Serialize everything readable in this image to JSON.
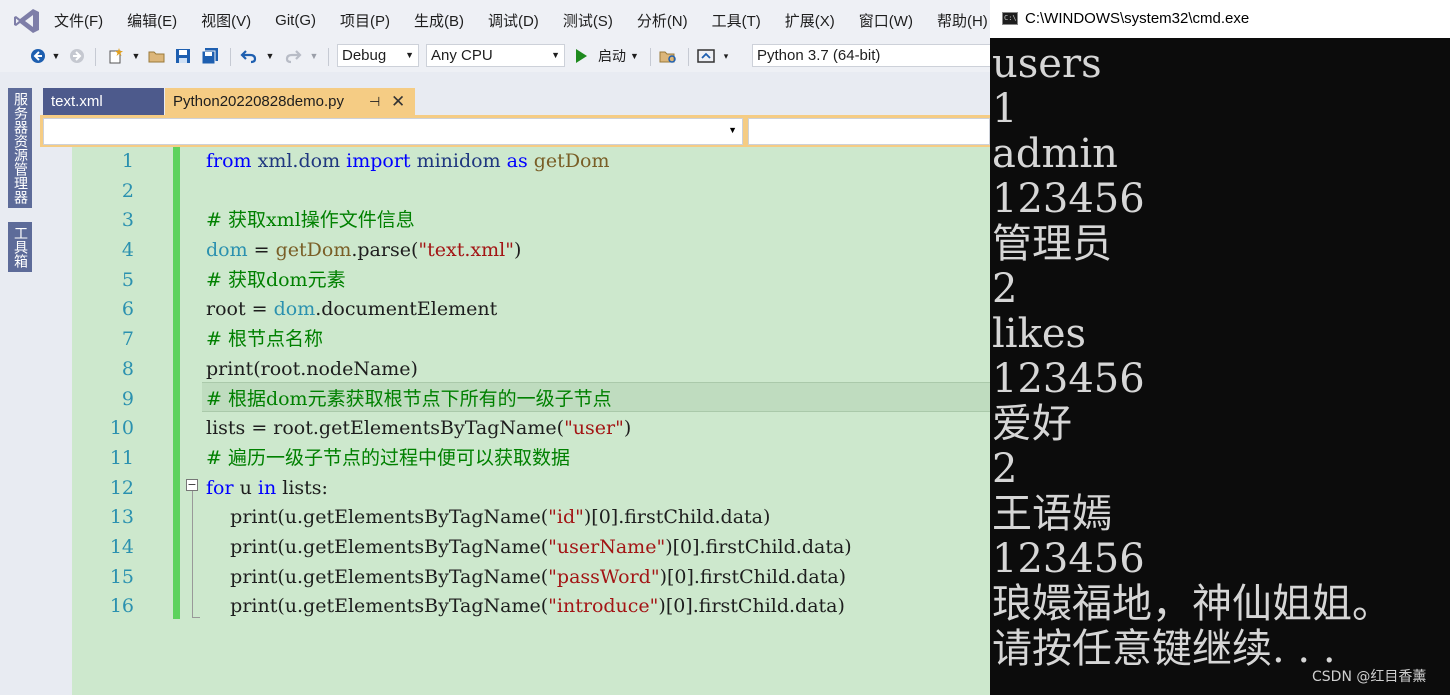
{
  "menu": {
    "items": [
      "文件(F)",
      "编辑(E)",
      "视图(V)",
      "Git(G)",
      "项目(P)",
      "生成(B)",
      "调试(D)",
      "测试(S)",
      "分析(N)",
      "工具(T)",
      "扩展(X)",
      "窗口(W)",
      "帮助(H)"
    ]
  },
  "toolbar": {
    "config": "Debug",
    "platform": "Any CPU",
    "start_label": "启动",
    "python_env": "Python 3.7 (64-bit)"
  },
  "side_tabs": {
    "server_explorer": "服务器资源管理器",
    "toolbox": "工具箱"
  },
  "tabs": {
    "text_xml": "text.xml",
    "py_file": "Python20220828demo.py"
  },
  "editor": {
    "line_numbers": [
      "1",
      "2",
      "3",
      "4",
      "5",
      "6",
      "7",
      "8",
      "9",
      "10",
      "11",
      "12",
      "13",
      "14",
      "15",
      "16"
    ],
    "code": {
      "l1_from": "from",
      "l1_mod": " xml.dom ",
      "l1_import": "import",
      "l1_name": " minidom ",
      "l1_as": "as",
      "l1_alias": " getDom",
      "l3": "# 获取xml操作文件信息",
      "l4_dom": "dom",
      "l4_eq": " = ",
      "l4_get": "getDom",
      "l4_parse": ".parse(",
      "l4_str": "\"text.xml\"",
      "l4_end": ")",
      "l5": "# 获取dom元素",
      "l6_root": "root = ",
      "l6_dom": "dom",
      "l6_rest": ".documentElement",
      "l7": "# 根节点名称",
      "l8": "print(root.nodeName)",
      "l9": "# 根据dom元素获取根节点下所有的一级子节点",
      "l10_a": "lists = root.getElementsByTagName(",
      "l10_str": "\"user\"",
      "l10_b": ")",
      "l11": "# 遍历一级子节点的过程中便可以获取数据",
      "l12_for": "for",
      "l12_u": " u ",
      "l12_in": "in",
      "l12_rest": " lists:",
      "l13_a": "    print(u.getElementsByTagName(",
      "l13_str": "\"id\"",
      "l13_b": ")[0].firstChild.data)",
      "l14_a": "    print(u.getElementsByTagName(",
      "l14_str": "\"userName\"",
      "l14_b": ")[0].firstChild.data)",
      "l15_a": "    print(u.getElementsByTagName(",
      "l15_str": "\"passWord\"",
      "l15_b": ")[0].firstChild.data)",
      "l16_a": "    print(u.getElementsByTagName(",
      "l16_str": "\"introduce\"",
      "l16_b": ")[0].firstChild.data)"
    }
  },
  "cmd": {
    "title": "C:\\WINDOWS\\system32\\cmd.exe",
    "icon_text": "C:\\",
    "output": [
      "users",
      "1",
      "admin",
      "123456",
      "管理员",
      "2",
      "likes",
      "123456",
      "爱好",
      "2",
      "王语嫣",
      "123456",
      "琅嬛福地，神仙姐姐。",
      "请按任意键继续. . ."
    ]
  },
  "watermark": "CSDN @红目香薰",
  "colors": {
    "editor_bg": "#cde8cd",
    "tab_active": "#f5cc84",
    "tab_inactive": "#4d5a8c",
    "cmd_bg": "#0c0c0c"
  }
}
